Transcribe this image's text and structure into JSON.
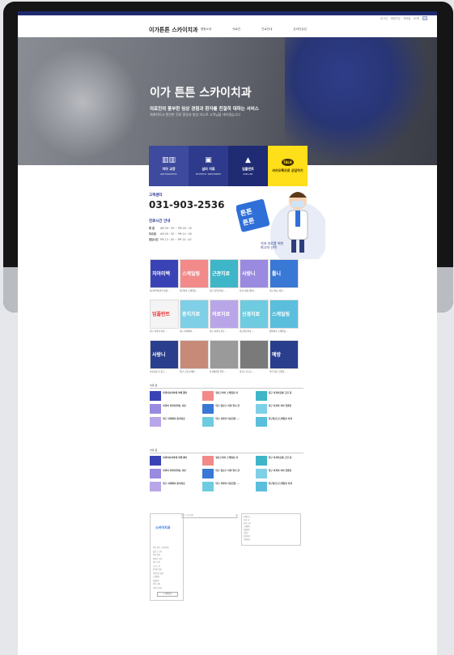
{
  "utility_links": [
    "로그인",
    "회원가입",
    "모바일",
    "KOR"
  ],
  "brand": {
    "logo_text": "이가튼튼 스카이치과"
  },
  "nav": {
    "items": [
      "병원소개",
      "의료진",
      "진료안내",
      "온라인상담"
    ]
  },
  "hero": {
    "title": "이가 튼튼 스카이치과",
    "subtitle": "의료진의 풍부한 임상 경험과 환자를 친절히 대하는 서비스",
    "description": "체계적이고 편안한 진료 환경과 항상 미소로 고객님을 대하겠습니다"
  },
  "quick_buttons": [
    {
      "label": "치아 교정",
      "sub": "ORTHODONTIC",
      "icon": "braces-icon"
    },
    {
      "label": "심미 치료",
      "sub": "ESTHETIC TREATMENT",
      "icon": "tooth-care-icon"
    },
    {
      "label": "임플란트",
      "sub": "IMPLANT",
      "icon": "implant-icon"
    },
    {
      "label": "카카오톡으로 상담하기",
      "sub": "",
      "icon": "kakaotalk-icon",
      "badge": "TALK"
    }
  ],
  "customer_center": {
    "label": "고객센터",
    "phone": "031-903-2536",
    "hours_title": "진료시간 안내",
    "hours": [
      {
        "day": "평 일",
        "time": "AM 09 : 30 ~ PM 18 : 30"
      },
      {
        "day": "토요일",
        "time": "AM 09 : 30 ~ PM 14 : 00"
      },
      {
        "day": "점심시간",
        "time": "PM 13 : 00 ~ PM 14 : 00"
      }
    ]
  },
  "mascot": {
    "sign_text": "튼튼 튼튼",
    "caption": "치과 지료를 위한 최고의 선택"
  },
  "gallery_row1": [
    {
      "title": "치아미백",
      "caption": "치아미백치과의 장점 ...",
      "color": "#3a43b5"
    },
    {
      "title": "스케일링",
      "caption": "일산치과 스케일링 ...",
      "color": "#f28a8a"
    },
    {
      "title": "근관치료",
      "caption": "대구 지루운치료 ...",
      "color": "#3fb5c8"
    },
    {
      "title": "사랑니",
      "caption": "치과 사랑니발치 ...",
      "color": "#9a8ae0"
    },
    {
      "title": "틀니",
      "caption": "대구 틀니 치과 ...",
      "color": "#3a78d6"
    }
  ],
  "gallery_row2": [
    {
      "title": "임플란트",
      "caption": "대구 치과의 치과 ...",
      "color": "#f4f4f4"
    },
    {
      "title": "충치치료",
      "caption": "대구 치과에서 ...",
      "color": "#7fd0e6"
    },
    {
      "title": "의료치료",
      "caption": "대구 치과의 진료 ...",
      "color": "#b9a6e8"
    },
    {
      "title": "신경치료",
      "caption": "대구일산치과 ...",
      "color": "#6fcbe0"
    },
    {
      "title": "스케일링",
      "caption": "월말치과 스케일링 ...",
      "color": "#5bbedc"
    }
  ],
  "gallery_row3": [
    {
      "title": "사랑니",
      "caption": "사랑니를 안 뽑고 ...",
      "color": "#2a3e8e"
    },
    {
      "title": "",
      "caption": "일산 구강검 예방 ...",
      "color": "#c78a78"
    },
    {
      "title": "",
      "caption": "치과병원을 위한 ...",
      "color": "#9a9a9a"
    },
    {
      "title": "",
      "caption": "일산구 진료소 ...",
      "color": "#7a7a7a"
    },
    {
      "title": "예방",
      "caption": "의학 치료 진행할 ...",
      "color": "#2a3e8e"
    }
  ],
  "list_section_1": {
    "header": "치과 글",
    "items": [
      {
        "title": "치과의사치아에 의해 뽑아",
        "color": "#3a43b5"
      },
      {
        "title": "일산구치아 스케일링 치",
        "color": "#f28a8a"
      },
      {
        "title": "대구 치과치료를 고민 중",
        "color": "#3fb5c8"
      },
      {
        "title": "치과의 치명사항에, 사랑",
        "color": "#9a8ae0"
      },
      {
        "title": "대구 일산구 치과 형니 관",
        "color": "#3a78d6"
      },
      {
        "title": "대구 치과의 치아 임플란",
        "color": "#7fd0e6"
      },
      {
        "title": "대구 치과에서 충치치료",
        "color": "#b9a6e8"
      },
      {
        "title": "대구 치과의 의료진을 ...",
        "color": "#6fcbe0"
      },
      {
        "title": "대구일산구스케일링 치과",
        "color": "#5bbedc"
      }
    ]
  },
  "list_section_2": {
    "header": "치과 글",
    "items": [
      {
        "title": "치과의사치아에 의해 뽑아",
        "color": "#3a43b5"
      },
      {
        "title": "일산구치아 스케일링 치",
        "color": "#f28a8a"
      },
      {
        "title": "대구 치과치료를 고민 중",
        "color": "#3fb5c8"
      },
      {
        "title": "치과의 치명사항에, 사랑",
        "color": "#9a8ae0"
      },
      {
        "title": "대구 일산구 치과 형니 관",
        "color": "#3a78d6"
      },
      {
        "title": "대구 치과의 치아 임플란",
        "color": "#7fd0e6"
      },
      {
        "title": "대구 치과에서 충치치료",
        "color": "#b9a6e8"
      },
      {
        "title": "대구 치과의 의료진을 ...",
        "color": "#6fcbe0"
      },
      {
        "title": "대구일산구스케일링 치과",
        "color": "#5bbedc"
      }
    ]
  },
  "sidebar": {
    "logo": "스카이치과",
    "links": [
      "이가 튼튼 스카이치과",
      "블로그 소개",
      "진료 안내",
      "의료진 소개",
      "진료 시간",
      "오시는 길",
      "온라인 상담",
      "카카오톡 상담",
      "스케일링",
      "임플란트",
      "치아 교정",
      "사랑니 발치"
    ],
    "button": "+ 이웃추가"
  },
  "search": {
    "placeholder": "블로그 내 검색"
  },
  "tags": {
    "lines": [
      "전체보기",
      "치과 글",
      "치과 소식",
      "스케일링",
      "임플란트",
      "사랑니",
      "충치치료",
      "신경치료"
    ]
  }
}
